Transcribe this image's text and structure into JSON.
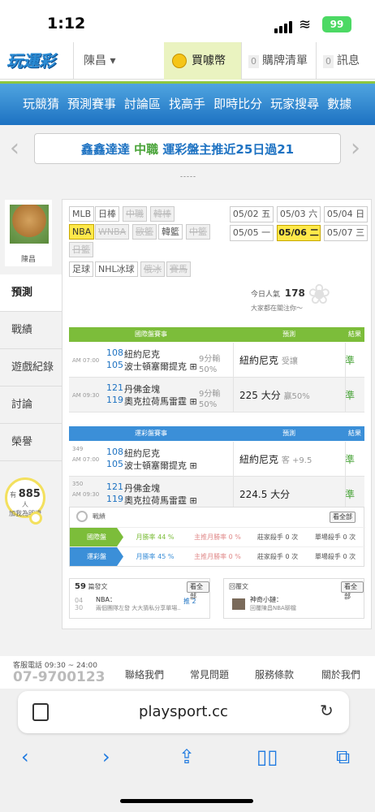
{
  "status": {
    "time": "1:12",
    "battery": "99"
  },
  "header": {
    "logo": "玩運彩",
    "user": "陳昌 ▾",
    "buy_coin": "買噱幣",
    "cart_count": "0",
    "cart_label": "購牌清單",
    "msg_count": "0",
    "msg_label": "訊息"
  },
  "nav": [
    "玩競猜",
    "預測賽事",
    "討論區",
    "找高手",
    "即時比分",
    "玩家搜尋",
    "數據"
  ],
  "banner": {
    "prefix": "鑫鑫達達",
    "highlight": "中職",
    "text": "運彩盤主推近25日過21",
    "left_arrow": "‹",
    "right_arrow": "›"
  },
  "profile": {
    "name": "陳昌",
    "tabs": [
      "預測",
      "戰績",
      "遊戲紀錄",
      "討論",
      "榮譽"
    ],
    "likes_prefix": "有",
    "likes_count": "885",
    "likes_suffix": "人",
    "likes_note": "加我為明燈"
  },
  "sports": [
    {
      "label": "MLB",
      "state": "normal"
    },
    {
      "label": "日棒",
      "state": "normal"
    },
    {
      "label": "中職",
      "state": "disabled"
    },
    {
      "label": "韓棒",
      "state": "disabled"
    },
    {
      "label": "NBA",
      "state": "selected"
    },
    {
      "label": "WNBA",
      "state": "disabled"
    },
    {
      "label": "歐籃",
      "state": "disabled"
    },
    {
      "label": "韓籃",
      "state": "normal"
    },
    {
      "label": "中籃",
      "state": "disabled"
    },
    {
      "label": "日籃",
      "state": "disabled"
    },
    {
      "label": "足球",
      "state": "normal"
    },
    {
      "label": "NHL冰球",
      "state": "normal"
    },
    {
      "label": "俄冰",
      "state": "disabled"
    },
    {
      "label": "賽馬",
      "state": "disabled"
    }
  ],
  "dates": [
    {
      "label": "05/02 五",
      "selected": false
    },
    {
      "label": "05/03 六",
      "selected": false
    },
    {
      "label": "05/04 日",
      "selected": false
    },
    {
      "label": "05/05 一",
      "selected": false
    },
    {
      "label": "05/06 二",
      "selected": true
    },
    {
      "label": "05/07 三",
      "selected": false
    }
  ],
  "popularity": {
    "label": "今日人氣",
    "value": "178",
    "note": "大家都在關注你～"
  },
  "intl_table": {
    "header": [
      "國際盤賽事",
      "預測",
      "結果"
    ],
    "rows": [
      {
        "time": "AM 07:00",
        "num_a": "108",
        "num_b": "105",
        "team_a": "紐約尼克",
        "team_b": "波士頓塞爾提克 ⊞",
        "ext": "9分輸 50%",
        "pick": "紐約尼克",
        "pick_note": "受讓",
        "result": "準"
      },
      {
        "time": "AM 09:30",
        "num_a": "121",
        "num_b": "119",
        "team_a": "丹佛金塊",
        "team_b": "奧克拉荷馬雷霆 ⊞",
        "ext": "9分輸 50%",
        "pick": "225 大分",
        "pick_note": "贏50%",
        "result": "準"
      }
    ]
  },
  "lottery_table": {
    "header": [
      "運彩盤賽事",
      "預測",
      "結果"
    ],
    "rows": [
      {
        "code": "349",
        "time": "AM 07:00",
        "num_a": "108",
        "num_b": "105",
        "team_a": "紐約尼克",
        "team_b": "波士頓塞爾提克 ⊞",
        "pick": "紐約尼克",
        "pick_note": "客 +9.5",
        "result": "準"
      },
      {
        "code": "350",
        "time": "AM 09:30",
        "num_a": "121",
        "num_b": "119",
        "team_a": "丹佛金塊",
        "team_b": "奧克拉荷馬雷霆 ⊞",
        "pick": "224.5 大分",
        "pick_note": "",
        "result": "準"
      }
    ]
  },
  "stats": {
    "title": "戰績",
    "all": "看全部",
    "rows": [
      {
        "label": "國際盤",
        "color": "#7cbd3a",
        "month": "月勝率 44 %",
        "main": "主推月勝率 0 %",
        "banker": "莊家殺手 0 次",
        "fail": "單場殺手 0 次"
      },
      {
        "label": "運彩盤",
        "color": "#3b8fd8",
        "month": "月勝率 45 %",
        "main": "主推月勝率 0 %",
        "banker": "莊家殺手 0 次",
        "fail": "單場殺手 0 次"
      }
    ]
  },
  "posts": {
    "count": "59",
    "label": "篇發文",
    "all": "看全部",
    "date": "04 30",
    "title": "NBA：",
    "snippet": "兩個團隊左發 大大猜私分享單場...",
    "badge": "推 2"
  },
  "replies": {
    "label": "回覆文",
    "all": "看全部",
    "title": "神奇小鏈：",
    "snippet": "回覆陳昌NBA聊檔"
  },
  "footer": {
    "service": "客服電話 09:30 ~ 24:00",
    "phone": "07-9700123",
    "links": [
      "聯絡我們",
      "常見問題",
      "服務條款",
      "關於我們"
    ]
  },
  "browser": {
    "url": "playsport.cc"
  },
  "colors": {
    "intl_header": "#7cbd3a",
    "lottery_header": "#3b8fd8",
    "nav": "#1d72c2",
    "accent": "#4aa43a"
  }
}
